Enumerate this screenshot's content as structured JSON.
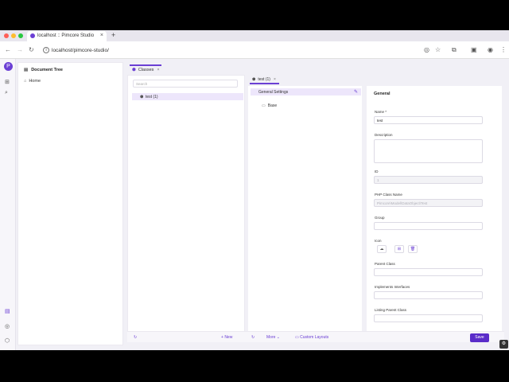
{
  "browser": {
    "tab_title": "localhost :: Pimcore Studio",
    "tab_close": "×",
    "new_tab": "+",
    "url": "localhost/pimcore-studio/"
  },
  "rail": {
    "avatar_letter": "P"
  },
  "document_tree": {
    "title": "Document Tree",
    "home": "Home"
  },
  "classes_tab": {
    "label": "Classes",
    "close": "×"
  },
  "class_list": {
    "search_placeholder": "Search",
    "items": [
      "test (1)"
    ]
  },
  "editor": {
    "tab_label": "test (1)",
    "tab_close": "×",
    "layout": {
      "general_settings": "General Settings",
      "base": "Base"
    },
    "form": {
      "title": "General",
      "name_label": "Name *",
      "name_value": "test",
      "description_label": "Description",
      "description_value": "",
      "id_label": "ID",
      "id_value": "1",
      "php_class_label": "PHP Class Name",
      "php_class_value": "Pimcore\\Model\\DataObject\\Test",
      "group_label": "Group",
      "icon_label": "Icon",
      "parent_class_label": "Parent Class",
      "implements_label": "Implements Interfaces",
      "listing_parent_label": "Listing Parent Class"
    }
  },
  "footer": {
    "new_label": "New",
    "more_label": "More",
    "custom_layouts_label": "Custom Layouts",
    "save_label": "Save"
  },
  "colors": {
    "accent": "#6b3fd4",
    "selected_row": "#ede6fb",
    "save_button": "#5a2cc9"
  }
}
